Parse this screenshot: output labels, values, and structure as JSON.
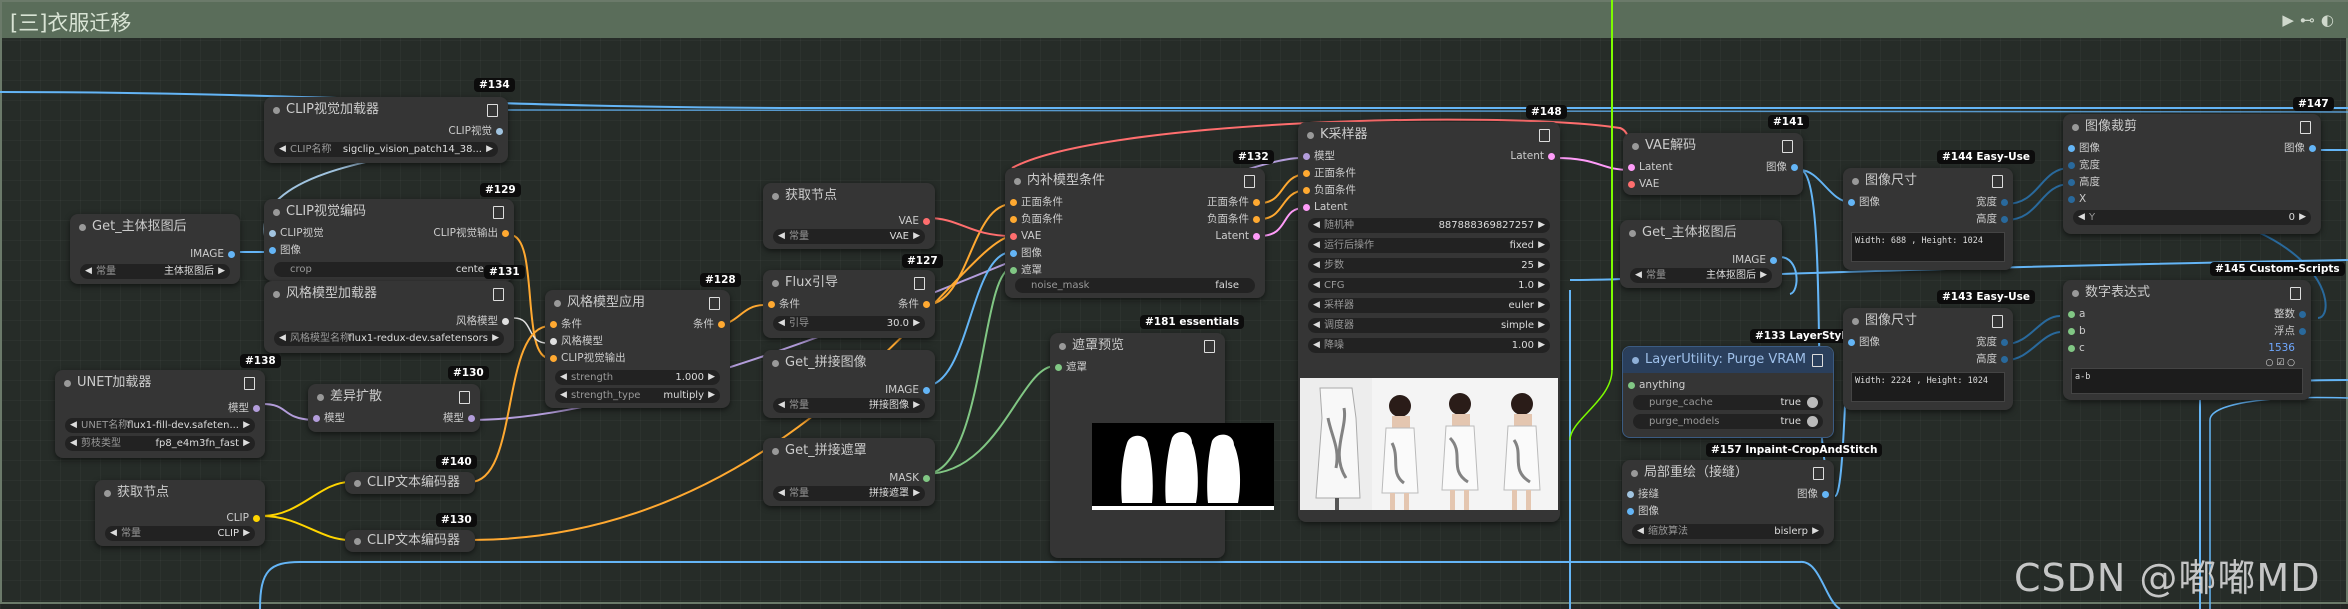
{
  "group": {
    "title": "[三]衣服迁移"
  },
  "nodes": {
    "clip_vision_loader": {
      "title": "CLIP视觉加载器",
      "out": "CLIP视觉",
      "w_label": "CLIP名称",
      "w_value": "sigclip_vision_patch14_38...",
      "badge": "#134"
    },
    "get_subject_1": {
      "title": "Get_主体抠图后",
      "out": "IMAGE",
      "w_label": "常量",
      "w_value": "主体抠图后"
    },
    "clip_vision_encode": {
      "title": "CLIP视觉编码",
      "in1": "CLIP视觉",
      "in2": "图像",
      "out": "CLIP视觉输出",
      "w_label": "crop",
      "w_value": "center",
      "badge": "#129"
    },
    "style_model_loader": {
      "title": "风格模型加载器",
      "out": "风格模型",
      "w_label": "风格模型名称",
      "w_value": "flux1-redux-dev.safetensors",
      "badge": "#131"
    },
    "unet_loader": {
      "title": "UNET加载器",
      "out": "模型",
      "w1_label": "UNET名称",
      "w1_value": "flux1-fill-dev.safeten...",
      "w2_label": "剪枝类型",
      "w2_value": "fp8_e4m3fn_fast",
      "badge": "#138"
    },
    "diff_diffusion": {
      "title": "差异扩散",
      "in": "模型",
      "out": "模型",
      "badge": "#130"
    },
    "style_model_apply": {
      "title": "风格模型应用",
      "in1": "条件",
      "in2": "风格模型",
      "in3": "CLIP视觉输出",
      "out": "条件",
      "w1_label": "strength",
      "w1_value": "1.000",
      "w2_label": "strength_type",
      "w2_value": "multiply",
      "badge": "#128"
    },
    "get_node_1": {
      "title": "获取节点",
      "out": "CLIP",
      "w_label": "常量",
      "w_value": "CLIP"
    },
    "clip_text_enc_1": {
      "title": "CLIP文本编码器",
      "badge": "#140"
    },
    "clip_text_enc_2": {
      "title": "CLIP文本编码器",
      "badge": "#130"
    },
    "get_node_2": {
      "title": "获取节点",
      "out": "VAE",
      "w_label": "常量",
      "w_value": "VAE"
    },
    "flux_guidance": {
      "title": "Flux引导",
      "in": "条件",
      "out": "条件",
      "w_label": "引导",
      "w_value": "30.0",
      "badge": "#127"
    },
    "get_concat_image": {
      "title": "Get_拼接图像",
      "out": "IMAGE",
      "w_label": "常量",
      "w_value": "拼接图像"
    },
    "get_concat_mask": {
      "title": "Get_拼接遮罩",
      "out": "MASK",
      "w_label": "常量",
      "w_value": "拼接遮罩"
    },
    "inpaint_cond": {
      "title": "内补模型条件",
      "in1": "正面条件",
      "in2": "负面条件",
      "in3": "VAE",
      "in4": "图像",
      "in5": "遮罩",
      "out1": "正面条件",
      "out2": "负面条件",
      "out3": "Latent",
      "w_label": "noise_mask",
      "w_value": "false",
      "badge": "#132"
    },
    "mask_preview": {
      "title": "遮罩预览",
      "in": "遮罩",
      "badge": "#181 essentials"
    },
    "ksampler": {
      "title": "K采样器",
      "in1": "模型",
      "in2": "正面条件",
      "in3": "负面条件",
      "in4": "Latent",
      "out": "Latent",
      "badge": "#148",
      "widgets": [
        {
          "label": "随机种",
          "value": "887888369827257"
        },
        {
          "label": "运行后操作",
          "value": "fixed"
        },
        {
          "label": "步数",
          "value": "25"
        },
        {
          "label": "CFG",
          "value": "1.0"
        },
        {
          "label": "采样器",
          "value": "euler"
        },
        {
          "label": "调度器",
          "value": "simple"
        },
        {
          "label": "降噪",
          "value": "1.00"
        }
      ]
    },
    "vae_decode": {
      "title": "VAE解码",
      "in1": "Latent",
      "in2": "VAE",
      "out": "图像",
      "badge": "#141"
    },
    "get_subject_2": {
      "title": "Get_主体抠图后",
      "out": "IMAGE",
      "w_label": "常量",
      "w_value": "主体抠图后"
    },
    "purge_vram": {
      "title": "LayerUtility: Purge VRAM",
      "in": "anything",
      "w1_label": "purge_cache",
      "w1_value": "true",
      "w2_label": "purge_models",
      "w2_value": "true",
      "badge": "#133 LayerStyle"
    },
    "stitch": {
      "title": "局部重绘（接缝）",
      "in1": "接缝",
      "in2": "图像",
      "out": "图像",
      "w_label": "缩放算法",
      "w_value": "bislerp",
      "badge": "#157 Inpaint-CropAndStitch"
    },
    "image_size_1": {
      "title": "图像尺寸",
      "in": "图像",
      "out1": "宽度",
      "out2": "高度",
      "text": "Width: 688 , Height: 1024",
      "badge": "#144 Easy-Use"
    },
    "image_size_2": {
      "title": "图像尺寸",
      "in": "图像",
      "out1": "宽度",
      "out2": "高度",
      "text": "Width: 2224 , Height: 1024",
      "badge": "#143 Easy-Use"
    },
    "image_crop": {
      "title": "图像裁剪",
      "in1": "图像",
      "in2": "宽度",
      "in3": "高度",
      "in4": "X",
      "out": "图像",
      "w_label": "Y",
      "w_value": "0",
      "badge": "#147"
    },
    "math_expr": {
      "title": "数字表达式",
      "in1": "a",
      "in2": "b",
      "in3": "c",
      "out1": "整数",
      "out2": "浮点",
      "c_value": "1536",
      "expr": "a-b",
      "badge": "#145 Custom-Scripts"
    }
  },
  "watermark": "CSDN @嘟嘟MD",
  "colors": {
    "clip_vision": "#a1c4e0",
    "image": "#64b5f6",
    "model": "#b39ddb",
    "cond": "#ffa931",
    "vae": "#ff6e6e",
    "latent": "#ff9cf9",
    "mask": "#81c784",
    "clip": "#ffd500",
    "int": "#29699c",
    "green_line": "#7cfc00"
  }
}
